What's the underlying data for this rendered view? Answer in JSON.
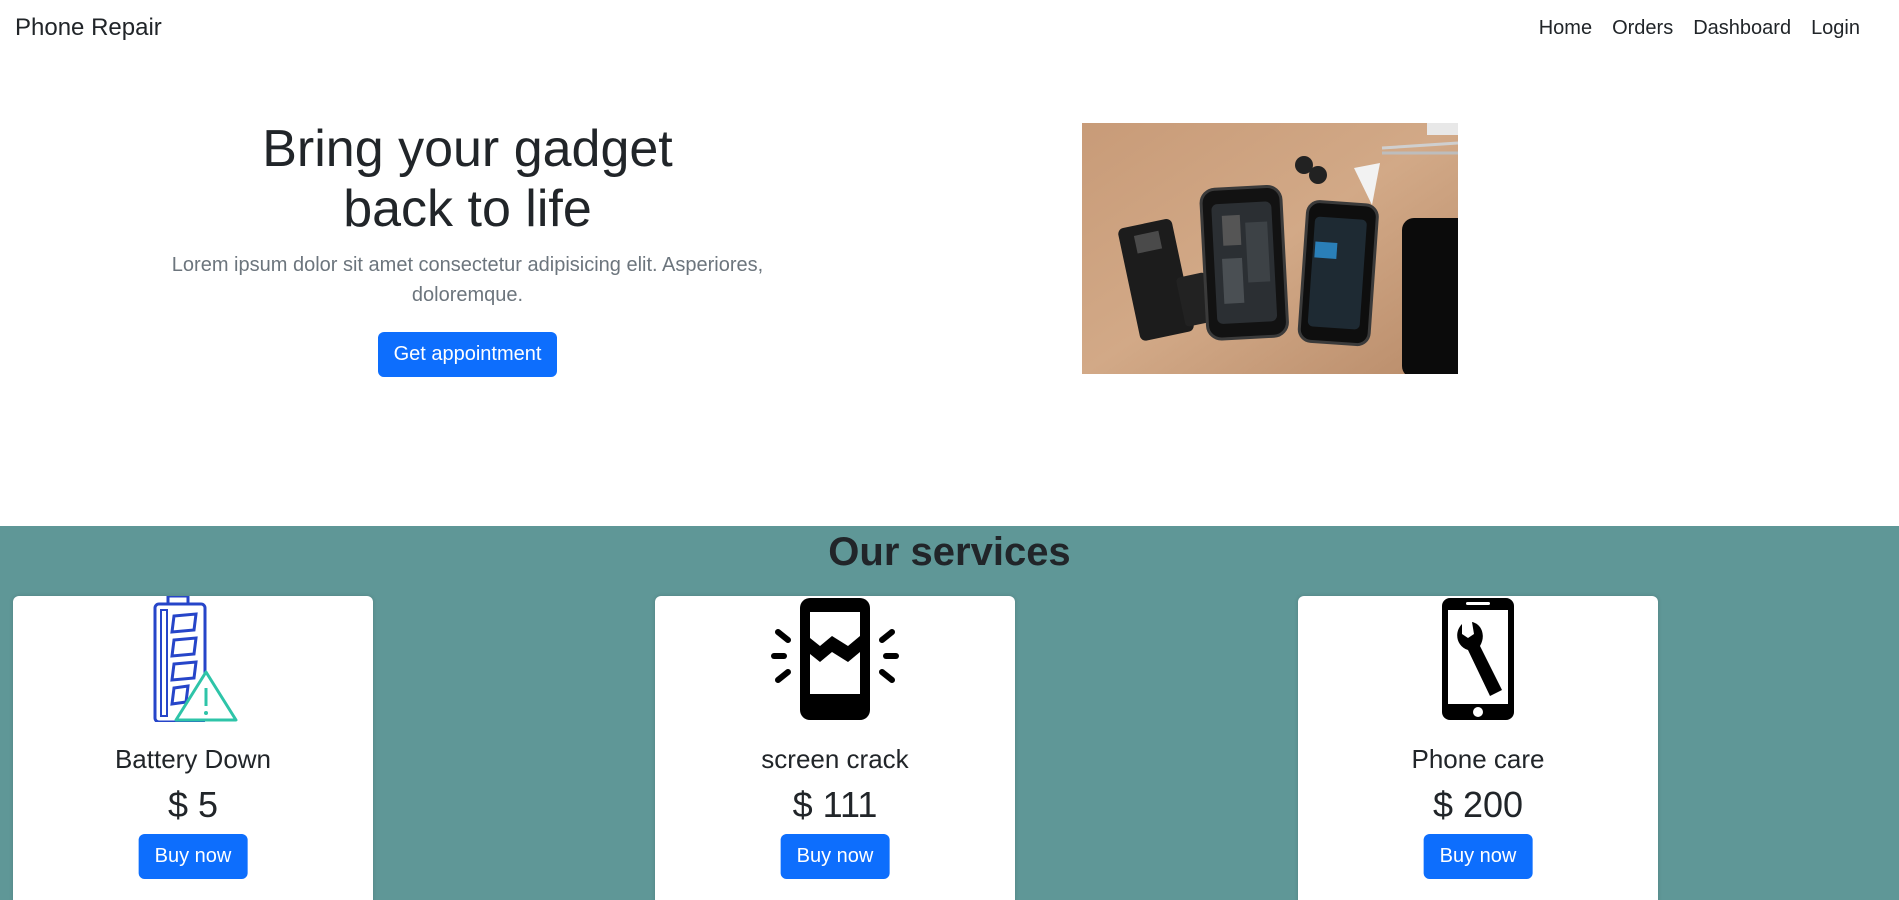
{
  "navbar": {
    "brand": "Phone Repair",
    "links": [
      "Home",
      "Orders",
      "Dashboard",
      "Login"
    ]
  },
  "hero": {
    "title_line1": "Bring your gadget",
    "title_line2": "back to life",
    "subtitle": "Lorem ipsum dolor sit amet consectetur adipisicing elit. Asperiores, doloremque.",
    "cta_label": "Get appointment",
    "image_icon": "phone-repair-photo"
  },
  "services": {
    "title": "Our services",
    "items": [
      {
        "title": "Battery Down",
        "price": "$ 5",
        "button": "Buy now",
        "icon": "battery-warning-icon"
      },
      {
        "title": "screen crack",
        "price": "$ 111",
        "button": "Buy now",
        "icon": "cracked-phone-icon"
      },
      {
        "title": "Phone care",
        "price": "$ 200",
        "button": "Buy now",
        "icon": "phone-wrench-icon"
      }
    ]
  },
  "colors": {
    "primary": "#0d6efd",
    "services_bg": "#5f9797",
    "text": "#212529",
    "muted": "#6c757d"
  }
}
